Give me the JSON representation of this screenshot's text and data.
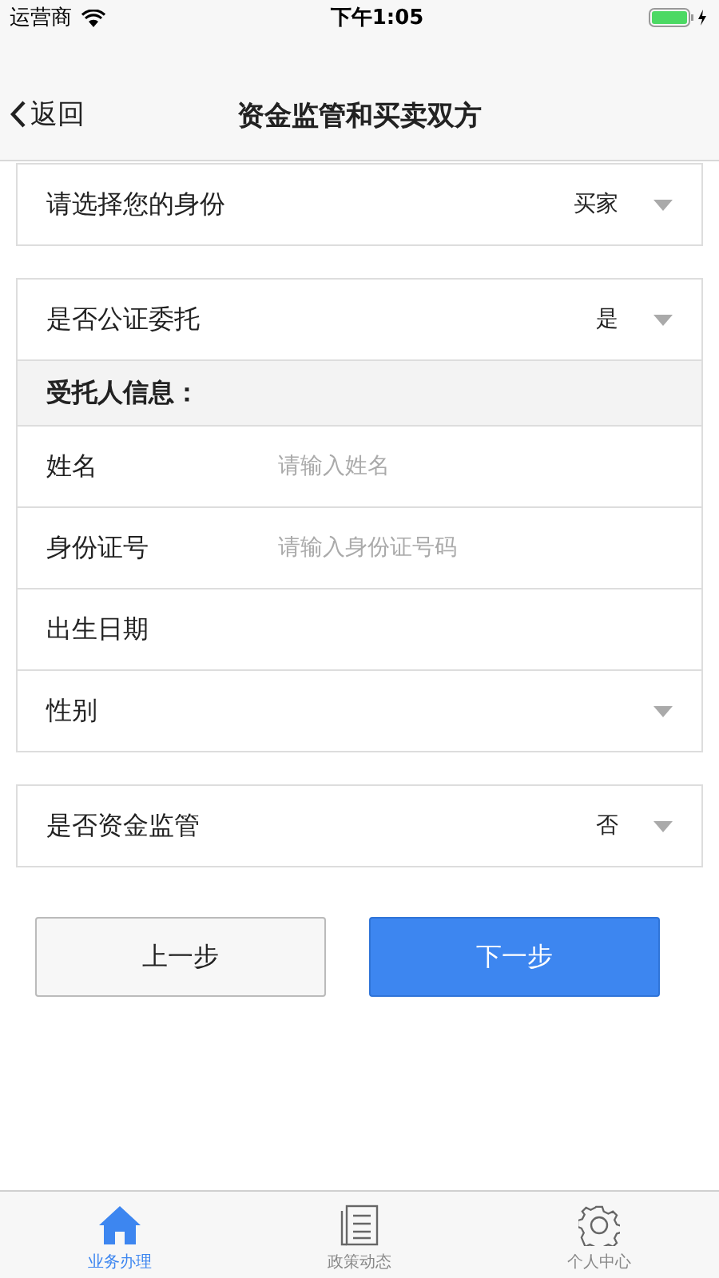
{
  "status_bar": {
    "carrier": "运营商",
    "time": "下午1:05"
  },
  "nav": {
    "back": "返回",
    "title": "资金监管和买卖双方"
  },
  "sections": [
    {
      "rows": [
        {
          "kind": "select",
          "label": "请选择您的身份",
          "value": "买家"
        }
      ]
    },
    {
      "rows": [
        {
          "kind": "select",
          "label": "是否公证委托",
          "value": "是"
        },
        {
          "kind": "header",
          "label": "受托人信息："
        },
        {
          "kind": "input",
          "label": "姓名",
          "placeholder": "请输入姓名"
        },
        {
          "kind": "input",
          "label": "身份证号",
          "placeholder": "请输入身份证号码"
        },
        {
          "kind": "plain",
          "label": "出生日期"
        },
        {
          "kind": "select",
          "label": "性别"
        }
      ]
    },
    {
      "rows": [
        {
          "kind": "select",
          "label": "是否资金监管",
          "value": "否"
        }
      ]
    }
  ],
  "buttons": [
    {
      "label": "上一步",
      "kind": "secondary"
    },
    {
      "label": "下一步",
      "kind": "primary"
    }
  ],
  "tabs": [
    {
      "label": "业务办理",
      "kind": "home",
      "selected": true
    },
    {
      "label": "政策动态",
      "kind": "doc",
      "selected": false
    },
    {
      "label": "个人中心",
      "kind": "gear",
      "selected": false
    }
  ]
}
